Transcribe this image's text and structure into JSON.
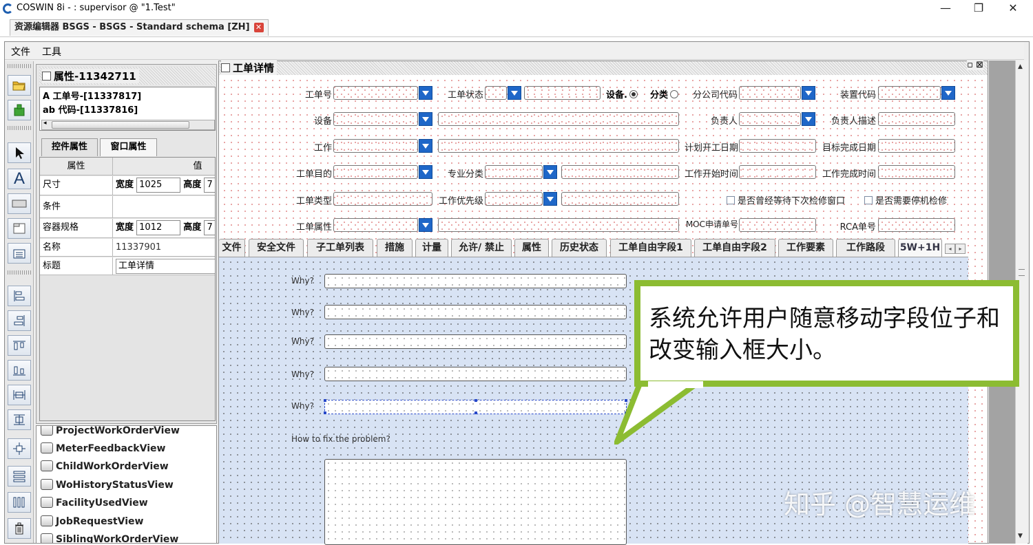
{
  "window": {
    "title": "COSWIN 8i -  : supervisor @ \"1.Test\"",
    "minimize": "—",
    "restore": "❐",
    "close": "✕"
  },
  "doc_tab": {
    "label": "资源编辑器 BSGS - BSGS - Standard schema [ZH]",
    "close": "✕"
  },
  "menu": {
    "file": "文件",
    "tools": "工具"
  },
  "properties_panel": {
    "title": "属性-11342711",
    "tree": [
      "A  工单号-[11337817]",
      "ab 代码-[11337816]"
    ],
    "tabs": [
      "控件属性",
      "窗口属性"
    ],
    "table_headers": {
      "key": "属性",
      "value": "值"
    },
    "rows": [
      {
        "key": "尺寸",
        "width_label": "宽度",
        "width": "1025",
        "height_label": "高度",
        "height": "7"
      },
      {
        "key": "条件"
      },
      {
        "key": "容器规格",
        "width_label": "宽度",
        "width": "1012",
        "height_label": "高度",
        "height": "7"
      },
      {
        "key": "名称",
        "value": "11337901"
      },
      {
        "key": "标题",
        "value": "工单详情"
      }
    ]
  },
  "views": [
    "ProjectWorkOrderView",
    "MeterFeedbackView",
    "ChildWorkOrderView",
    "WoHistoryStatusView",
    "FacilityUsedView",
    "JobRequestView",
    "SiblingWorkOrderView"
  ],
  "designer": {
    "title": "工单详情",
    "title_buttons": "▫  ⊠",
    "fields": {
      "wo_no": "工单号",
      "wo_status": "工单状态",
      "device": "设备",
      "classification": "分类",
      "branch_code": "分公司代码",
      "unit_code": "装置代码",
      "equipment": "设备",
      "owner": "负责人",
      "owner_desc": "负责人描述",
      "work": "工作",
      "planned_start": "计划开工日期",
      "target_finish": "目标完成日期",
      "wo_purpose": "工单目的",
      "discipline": "专业分类",
      "work_start": "工作开始时间",
      "work_finish": "工作完成时间",
      "wo_type": "工单类型",
      "priority": "工作优先级",
      "waited_window": "是否曾经等待下次检修窗口",
      "need_shutdown": "是否需要停机检修",
      "wo_attr": "工单属性",
      "moc_no": "MOC申请单号",
      "rca_no": "RCA单号"
    },
    "tabs": [
      "文件",
      "安全文件",
      "子工单列表",
      "措施",
      "计量",
      "允许/ 禁止",
      "属性",
      "历史状态",
      "工单自由字段1",
      "工单自由字段2",
      "工作要素",
      "工作路段",
      "5W+1H"
    ],
    "tab_nav": [
      "◂",
      "▸"
    ],
    "whys": [
      "Why?",
      "Why?",
      "Why?",
      "Why?",
      "Why?"
    ],
    "fix_label": "How to fix the problem?"
  },
  "callout": {
    "text": "系统允许用户随意移动字段位子和改变输入框大小。",
    "border_color": "#8cbc32"
  },
  "watermark": "知乎 @智慧运维"
}
